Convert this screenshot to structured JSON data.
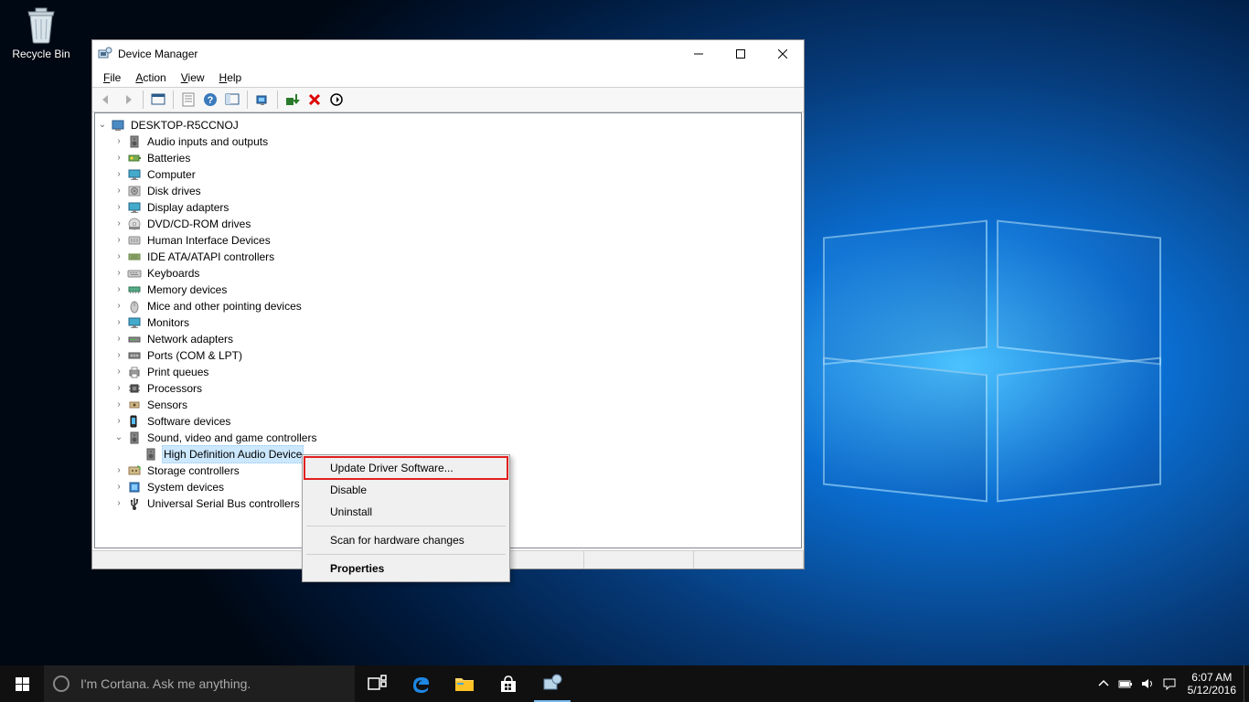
{
  "desktop": {
    "recycle_bin": "Recycle Bin"
  },
  "window": {
    "title": "Device Manager",
    "menus": {
      "file": "File",
      "action": "Action",
      "view": "View",
      "help": "Help"
    },
    "root": "DESKTOP-R5CCNOJ",
    "categories": [
      "Audio inputs and outputs",
      "Batteries",
      "Computer",
      "Disk drives",
      "Display adapters",
      "DVD/CD-ROM drives",
      "Human Interface Devices",
      "IDE ATA/ATAPI controllers",
      "Keyboards",
      "Memory devices",
      "Mice and other pointing devices",
      "Monitors",
      "Network adapters",
      "Ports (COM & LPT)",
      "Print queues",
      "Processors",
      "Sensors",
      "Software devices",
      "Sound, video and game controllers",
      "Storage controllers",
      "System devices",
      "Universal Serial Bus controllers"
    ],
    "expanded_child": "High Definition Audio Device"
  },
  "context_menu": {
    "update": "Update Driver Software...",
    "disable": "Disable",
    "uninstall": "Uninstall",
    "scan": "Scan for hardware changes",
    "properties": "Properties"
  },
  "taskbar": {
    "search_placeholder": "I'm Cortana. Ask me anything.",
    "time": "6:07 AM",
    "date": "5/12/2016"
  }
}
